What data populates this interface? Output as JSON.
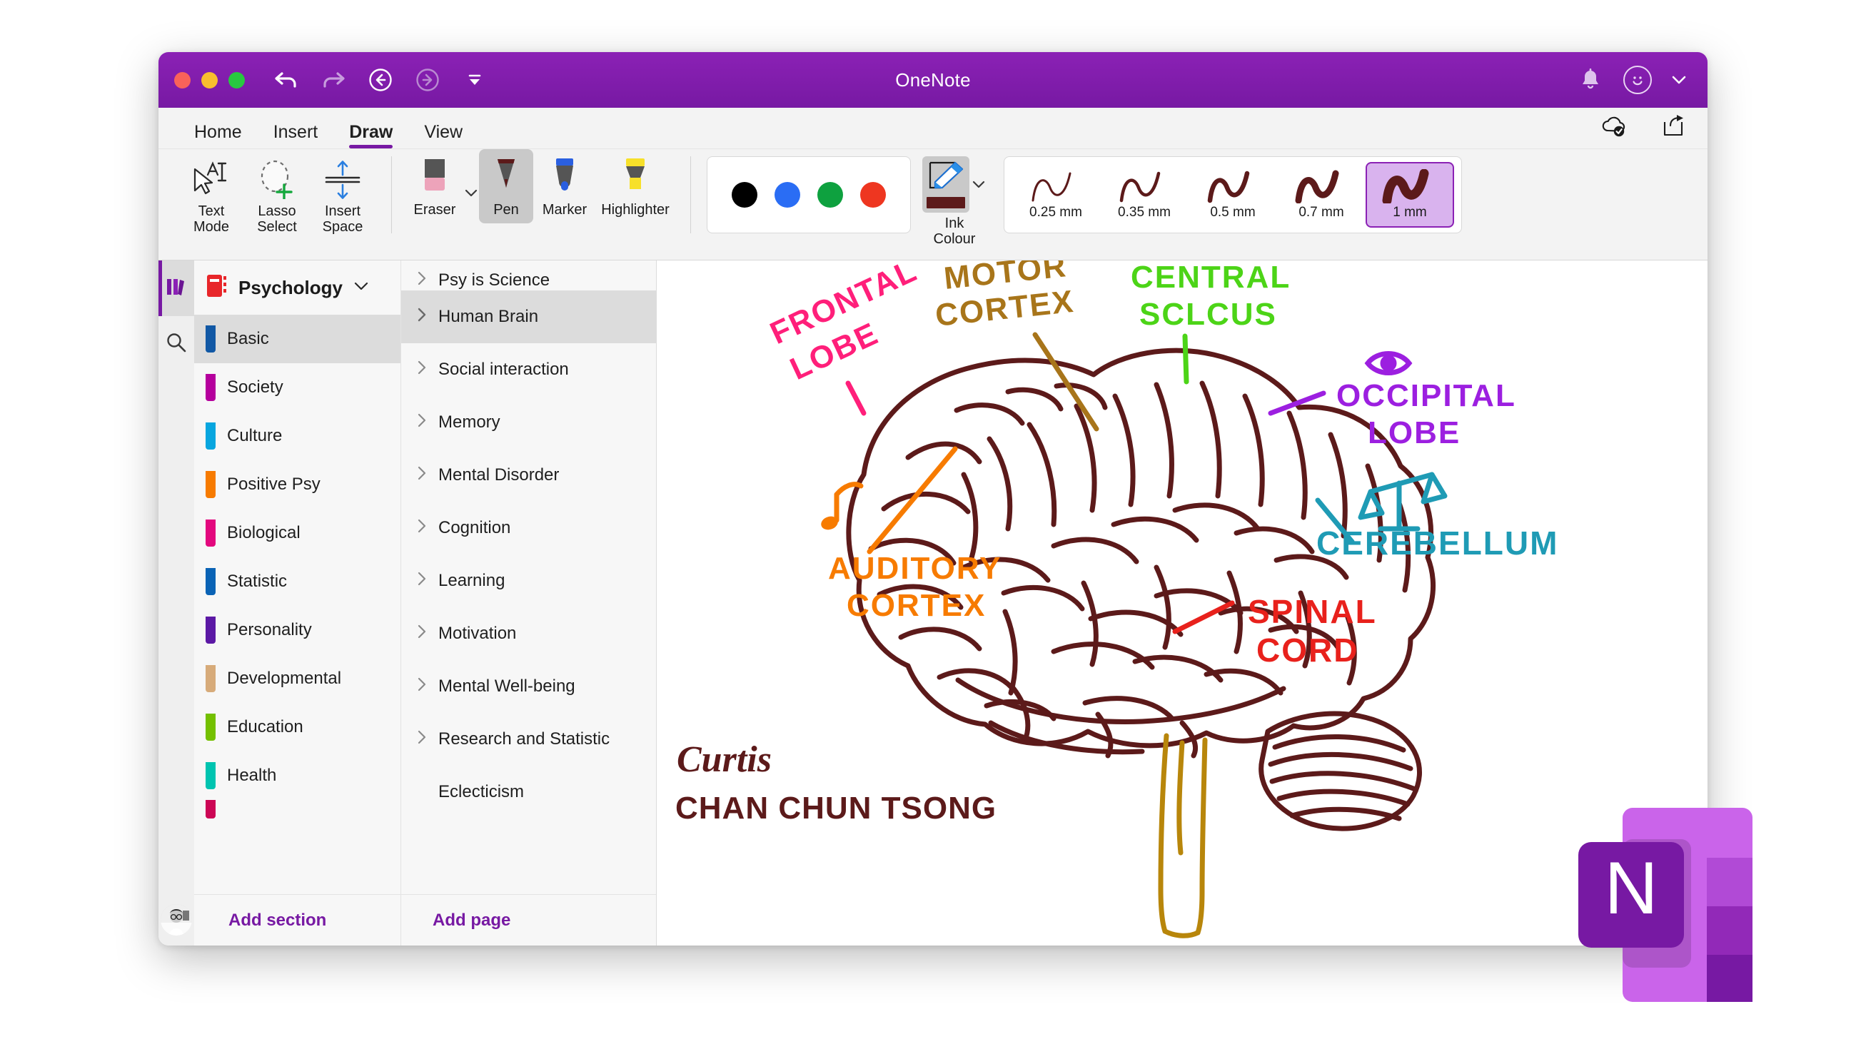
{
  "window": {
    "title": "OneNote",
    "traffic_lights": [
      "close",
      "minimize",
      "maximize"
    ],
    "titlebar_icons": [
      "undo-icon",
      "redo-icon",
      "back-icon",
      "forward-icon",
      "overflow-caret-icon"
    ],
    "titlebar_right_icons": [
      "bell-icon",
      "account-avatar-icon",
      "chevron-down-icon"
    ]
  },
  "ribbon": {
    "tabs": [
      {
        "label": "Home",
        "active": false
      },
      {
        "label": "Insert",
        "active": false
      },
      {
        "label": "Draw",
        "active": true
      },
      {
        "label": "View",
        "active": false
      }
    ],
    "right_icons": [
      "cloud-synced-icon",
      "share-icon"
    ],
    "tools": [
      {
        "label": "Text\nMode",
        "label_l1": "Text",
        "label_l2": "Mode",
        "icon": "text-mode-icon"
      },
      {
        "label": "Lasso\nSelect",
        "label_l1": "Lasso",
        "label_l2": "Select",
        "icon": "lasso-select-icon"
      },
      {
        "label": "Insert\nSpace",
        "label_l1": "Insert",
        "label_l2": "Space",
        "icon": "insert-space-icon"
      }
    ],
    "pens": [
      {
        "label": "Eraser",
        "icon": "eraser-icon",
        "selected": false,
        "has_caret": true
      },
      {
        "label": "Pen",
        "icon": "pen-icon",
        "selected": true,
        "has_caret": false
      },
      {
        "label": "Marker",
        "icon": "marker-icon",
        "selected": false,
        "has_caret": false
      },
      {
        "label": "Highlighter",
        "icon": "highlighter-icon",
        "selected": false,
        "has_caret": false
      }
    ],
    "colors": [
      {
        "name": "black",
        "hex": "#000000"
      },
      {
        "name": "blue",
        "hex": "#2a6df4"
      },
      {
        "name": "green",
        "hex": "#0ea13f"
      },
      {
        "name": "red",
        "hex": "#ee3620"
      }
    ],
    "ink_colour": {
      "label_l1": "Ink",
      "label_l2": "Colour",
      "current_hex": "#5c1a1a",
      "icon": "ink-colour-pencil-icon",
      "has_caret": true
    },
    "thickness": [
      {
        "label": "0.25 mm",
        "stroke": 3,
        "selected": false
      },
      {
        "label": "0.35 mm",
        "stroke": 4.5,
        "selected": false
      },
      {
        "label": "0.5 mm",
        "stroke": 6.5,
        "selected": false
      },
      {
        "label": "0.7 mm",
        "stroke": 9,
        "selected": false
      },
      {
        "label": "1 mm",
        "stroke": 13,
        "selected": true
      }
    ],
    "stroke_preview_hex": "#5c1a1a"
  },
  "rail": {
    "items": [
      {
        "name": "notebooks-icon",
        "active": true
      },
      {
        "name": "search-icon",
        "active": false
      }
    ]
  },
  "notebook": {
    "name": "Psychology",
    "icon": "notebook-icon",
    "icon_hex": "#e8262a",
    "chevron": "chevron-down-icon"
  },
  "sections": {
    "items": [
      {
        "label": "Basic",
        "hex": "#1158a5",
        "active": true
      },
      {
        "label": "Society",
        "hex": "#b5009d",
        "active": false
      },
      {
        "label": "Culture",
        "hex": "#08a6df",
        "active": false
      },
      {
        "label": "Positive Psy",
        "hex": "#f77b00",
        "active": false
      },
      {
        "label": "Biological",
        "hex": "#e3087e",
        "active": false
      },
      {
        "label": "Statistic",
        "hex": "#0a63b5",
        "active": false
      },
      {
        "label": "Personality",
        "hex": "#5c19a5",
        "active": false
      },
      {
        "label": "Developmental",
        "hex": "#d7ab7a",
        "active": false
      },
      {
        "label": "Education",
        "hex": "#74c000",
        "active": false
      },
      {
        "label": "Health",
        "hex": "#00c4b0",
        "active": false
      },
      {
        "label": "",
        "hex": "#cc0655",
        "active": false
      }
    ],
    "add_label": "Add section"
  },
  "pages": {
    "items": [
      {
        "label": "Psy is Science",
        "active": false,
        "expandable": true,
        "clipped": true
      },
      {
        "label": "Human Brain",
        "active": true,
        "expandable": true,
        "clipped": false
      },
      {
        "label": "Social interaction",
        "active": false,
        "expandable": true,
        "clipped": false
      },
      {
        "label": "Memory",
        "active": false,
        "expandable": true,
        "clipped": false
      },
      {
        "label": "Mental Disorder",
        "active": false,
        "expandable": true,
        "clipped": false
      },
      {
        "label": "Cognition",
        "active": false,
        "expandable": true,
        "clipped": false
      },
      {
        "label": "Learning",
        "active": false,
        "expandable": true,
        "clipped": false
      },
      {
        "label": "Motivation",
        "active": false,
        "expandable": true,
        "clipped": false
      },
      {
        "label": "Mental Well-being",
        "active": false,
        "expandable": true,
        "clipped": false
      },
      {
        "label": "Research and Statistic",
        "active": false,
        "expandable": true,
        "clipped": false
      },
      {
        "label": "Eclecticism",
        "active": false,
        "expandable": false,
        "clipped": false
      }
    ],
    "add_label": "Add page",
    "chevron_icon": "chevron-right-icon"
  },
  "canvas": {
    "drawing_name": "human-brain-diagram",
    "brain_stroke_hex": "#5c1a1a",
    "annotations": [
      {
        "text_l1": "FRONTAL",
        "text_l2": "LOBE",
        "hex": "#ff1f7a",
        "name": "label-frontal-lobe"
      },
      {
        "text_l1": "MOTOR",
        "text_l2": "CORTEX",
        "hex": "#a8751a",
        "name": "label-motor-cortex"
      },
      {
        "text_l1": "CENTRAL",
        "text_l2": "SCLCUS",
        "hex": "#4cd417",
        "name": "label-central-sclcus"
      },
      {
        "text_l1": "OCCIPITAL",
        "text_l2": "LOBE",
        "hex": "#9c1fe0",
        "name": "label-occipital-lobe"
      },
      {
        "text_l1": "CEREBELLUM",
        "text_l2": "",
        "hex": "#1f9bb5",
        "name": "label-cerebellum"
      },
      {
        "text_l1": "AUDITORY",
        "text_l2": "CORTEX",
        "hex": "#f77b00",
        "name": "label-auditory-cortex"
      },
      {
        "text_l1": "SPINAL",
        "text_l2": "CORD",
        "hex": "#e8211c",
        "name": "label-spinal-cord"
      }
    ],
    "doodles": [
      {
        "name": "eye-doodle",
        "hex": "#9c1fe0"
      },
      {
        "name": "scales-doodle",
        "hex": "#1f9bb5"
      },
      {
        "name": "music-note-doodle",
        "hex": "#f77b00"
      }
    ],
    "signature": {
      "line1": "Curtis",
      "line2": "CHAN CHUN TSONG",
      "hex": "#5c1a1a"
    }
  },
  "app_logo": {
    "letter": "N",
    "name": "onenote-logo"
  }
}
